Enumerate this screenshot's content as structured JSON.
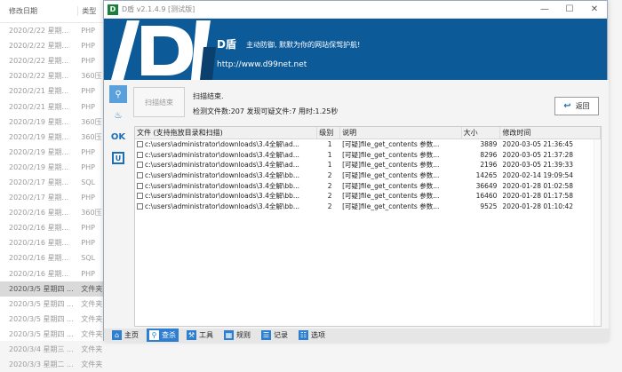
{
  "explorer": {
    "col_date": "修改日期",
    "col_type": "类型",
    "rows": [
      {
        "date": "2020/2/22 星期...",
        "type": "PHP"
      },
      {
        "date": "2020/2/22 星期...",
        "type": "PHP"
      },
      {
        "date": "2020/2/22 星期...",
        "type": "PHP"
      },
      {
        "date": "2020/2/22 星期...",
        "type": "360压"
      },
      {
        "date": "2020/2/21 星期...",
        "type": "PHP"
      },
      {
        "date": "2020/2/21 星期...",
        "type": "PHP"
      },
      {
        "date": "2020/2/19 星期...",
        "type": "360压"
      },
      {
        "date": "2020/2/19 星期...",
        "type": "360压"
      },
      {
        "date": "2020/2/19 星期...",
        "type": "PHP"
      },
      {
        "date": "2020/2/19 星期...",
        "type": "PHP"
      },
      {
        "date": "2020/2/17 星期...",
        "type": "SQL"
      },
      {
        "date": "2020/2/17 星期...",
        "type": "PHP"
      },
      {
        "date": "2020/2/16 星期...",
        "type": "360压"
      },
      {
        "date": "2020/2/16 星期...",
        "type": "PHP"
      },
      {
        "date": "2020/2/16 星期...",
        "type": "PHP"
      },
      {
        "date": "2020/2/16 星期...",
        "type": "SQL"
      },
      {
        "date": "2020/2/16 星期...",
        "type": "PHP"
      },
      {
        "date": "2020/3/5 星期四 ...",
        "type": "文件夹",
        "selected": true
      },
      {
        "date": "2020/3/5 星期四 ...",
        "type": "文件夹"
      },
      {
        "date": "2020/3/5 星期四 ...",
        "type": "文件夹"
      },
      {
        "date": "2020/3/5 星期四 ...",
        "type": "文件夹"
      },
      {
        "date": "2020/3/4 星期三 ...",
        "type": "文件夹"
      },
      {
        "date": "2020/3/3 星期二 ...",
        "type": "文件夹"
      }
    ]
  },
  "app": {
    "logo_letter": "D",
    "title": "D盾 v2.1.4.9 [测试版]",
    "win_min": "—",
    "win_max": "☐",
    "win_close": "✕"
  },
  "banner": {
    "brand": "D盾",
    "slogan": "主动防御, 默默为你的网站保驾护航!",
    "url": "http://www.d99net.net"
  },
  "side": {
    "scan_icon": "search-icon",
    "fire_icon": "fire-icon",
    "ok_label": "OK",
    "u_label": "U"
  },
  "scan": {
    "button": "扫描结束",
    "status": "扫描结束.",
    "stats": "检测文件数:207 发现可疑文件:7 用时:1.25秒",
    "back_button": "返回"
  },
  "table": {
    "headers": [
      "文件 (支持拖放目录和扫描)",
      "级别",
      "说明",
      "大小",
      "修改时间"
    ],
    "rows": [
      {
        "file": "c:\\users\\administrator\\downloads\\3.4全解\\ad...",
        "level": "1",
        "desc": "[可疑]file_get_contents 参数...",
        "size": "3889",
        "time": "2020-03-05 21:36:45"
      },
      {
        "file": "c:\\users\\administrator\\downloads\\3.4全解\\ad...",
        "level": "1",
        "desc": "[可疑]file_get_contents 参数...",
        "size": "8296",
        "time": "2020-03-05 21:37:28"
      },
      {
        "file": "c:\\users\\administrator\\downloads\\3.4全解\\ad...",
        "level": "1",
        "desc": "[可疑]file_get_contents 参数...",
        "size": "2196",
        "time": "2020-03-05 21:39:33"
      },
      {
        "file": "c:\\users\\administrator\\downloads\\3.4全解\\bb...",
        "level": "2",
        "desc": "[可疑]file_get_contents 参数...",
        "size": "14265",
        "time": "2020-02-14 19:09:54"
      },
      {
        "file": "c:\\users\\administrator\\downloads\\3.4全解\\bb...",
        "level": "2",
        "desc": "[可疑]file_get_contents 参数...",
        "size": "36649",
        "time": "2020-01-28 01:02:58"
      },
      {
        "file": "c:\\users\\administrator\\downloads\\3.4全解\\bb...",
        "level": "2",
        "desc": "[可疑]file_get_contents 参数...",
        "size": "16460",
        "time": "2020-01-28 01:17:58"
      },
      {
        "file": "c:\\users\\administrator\\downloads\\3.4全解\\bb...",
        "level": "2",
        "desc": "[可疑]file_get_contents 参数...",
        "size": "9525",
        "time": "2020-01-28 01:10:42"
      }
    ]
  },
  "toolbar": {
    "items": [
      {
        "label": "主页",
        "icon": "home-icon",
        "glyph": "⌂"
      },
      {
        "label": "查杀",
        "icon": "search-icon",
        "glyph": "⚲",
        "active": true
      },
      {
        "label": "工具",
        "icon": "tools-icon",
        "glyph": "⚒"
      },
      {
        "label": "规则",
        "icon": "grid-icon",
        "glyph": "▦"
      },
      {
        "label": "记录",
        "icon": "log-icon",
        "glyph": "☰"
      },
      {
        "label": "选项",
        "icon": "options-icon",
        "glyph": "☷"
      }
    ]
  }
}
